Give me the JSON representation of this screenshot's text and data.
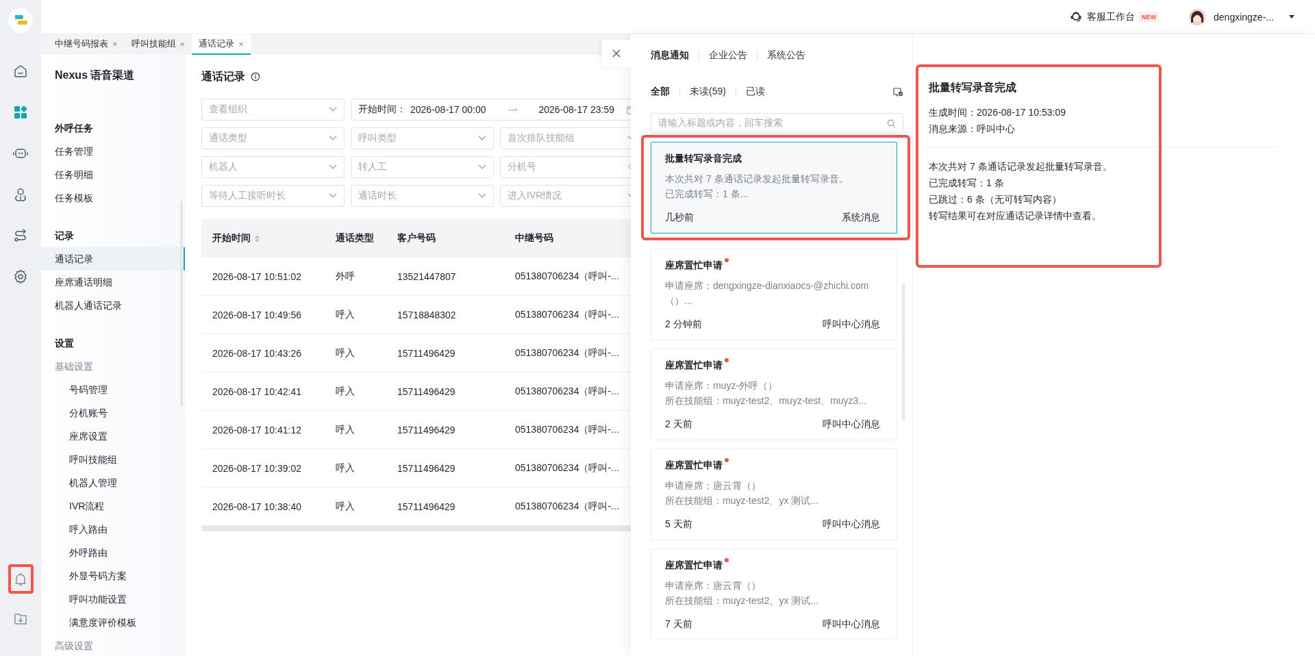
{
  "rail": {
    "items": [
      {
        "selected": false
      },
      {
        "selected": true
      },
      {
        "selected": false
      },
      {
        "selected": false
      },
      {
        "selected": false
      },
      {
        "selected": false
      }
    ],
    "bottom": [
      {
        "highlighted": true
      },
      {
        "highlighted": false
      }
    ]
  },
  "top_bar": {
    "workbench": "客服工作台",
    "badge": "NEW",
    "user": "dengxingze-..."
  },
  "tabs": [
    {
      "label": "中继号码报表",
      "close": "×",
      "selected": false
    },
    {
      "label": "呼叫技能组",
      "close": "×",
      "selected": false
    },
    {
      "label": "通话记录",
      "close": "×",
      "selected": true
    }
  ],
  "nav": {
    "title": "Nexus 语音渠道",
    "groups": [
      {
        "heading": "外呼任务",
        "items": [
          {
            "kind": "link",
            "label": "任务管理",
            "selected": false
          },
          {
            "kind": "link",
            "label": "任务明细",
            "selected": false
          },
          {
            "kind": "link",
            "label": "任务模板",
            "selected": false
          }
        ]
      },
      {
        "heading": "记录",
        "items": [
          {
            "kind": "link",
            "label": "通话记录",
            "selected": true
          },
          {
            "kind": "link",
            "label": "座席通话明细",
            "selected": false
          },
          {
            "kind": "link",
            "label": "机器人通话记录",
            "selected": false
          }
        ]
      },
      {
        "heading": "设置",
        "items": [
          {
            "kind": "section",
            "label": "基础设置",
            "children": [
              {
                "label": "号码管理",
                "selected": false
              },
              {
                "label": "分机账号",
                "selected": false
              },
              {
                "label": "座席设置",
                "selected": false
              },
              {
                "label": "呼叫技能组",
                "selected": false
              },
              {
                "label": "机器人管理",
                "selected": false
              },
              {
                "label": "IVR流程",
                "selected": false
              },
              {
                "label": "呼入路由",
                "selected": false
              },
              {
                "label": "外呼路由",
                "selected": false
              },
              {
                "label": "外显号码方案",
                "selected": false
              },
              {
                "label": "呼叫功能设置",
                "selected": false
              },
              {
                "label": "满意度评价模板",
                "selected": false
              }
            ]
          },
          {
            "kind": "section",
            "label": "高级设置"
          }
        ]
      }
    ]
  },
  "page": {
    "title": "通话记录",
    "filters": [
      {
        "kind": "select",
        "placeholder": "查看组织"
      },
      {
        "kind": "range",
        "label": "开始时间：",
        "start": "2026-08-17 00:00",
        "end": "2026-08-17 23:59"
      },
      {
        "kind": "select",
        "placeholder": "通话类型"
      },
      {
        "kind": "select",
        "placeholder": "呼叫类型"
      },
      {
        "kind": "select",
        "placeholder": "首次排队技能组"
      },
      {
        "kind": "select",
        "placeholder": "机器人"
      },
      {
        "kind": "select",
        "placeholder": "转人工"
      },
      {
        "kind": "search",
        "placeholder": "分机号"
      },
      {
        "kind": "select",
        "placeholder": "等待人工接听时长"
      },
      {
        "kind": "select",
        "placeholder": "通话时长"
      },
      {
        "kind": "select",
        "placeholder": "进入IVR情况"
      }
    ],
    "table": {
      "columns": [
        {
          "label": "开始时间",
          "sortable": true
        },
        {
          "label": "通话类型",
          "sortable": false
        },
        {
          "label": "客户号码",
          "sortable": false
        },
        {
          "label": "中继号码",
          "sortable": false
        }
      ],
      "rows": [
        [
          "2026-08-17 10:51:02",
          "外呼",
          "13521447807",
          "051380706234（呼叫-..."
        ],
        [
          "2026-08-17 10:49:56",
          "呼入",
          "15718848302",
          "051380706234（呼叫-..."
        ],
        [
          "2026-08-17 10:43:26",
          "呼入",
          "15711496429",
          "051380706234（呼叫-..."
        ],
        [
          "2026-08-17 10:42:41",
          "呼入",
          "15711496429",
          "051380706234（呼叫-..."
        ],
        [
          "2026-08-17 10:41:12",
          "呼入",
          "15711496429",
          "051380706234（呼叫-..."
        ],
        [
          "2026-08-17 10:39:02",
          "呼入",
          "15711496429",
          "051380706234（呼叫-..."
        ],
        [
          "2026-08-17 10:38:40",
          "呼入",
          "15711496429",
          "051380706234（呼叫-..."
        ]
      ]
    }
  },
  "drawer": {
    "tabs": [
      {
        "label": "消息通知",
        "selected": true
      },
      {
        "label": "企业公告",
        "selected": false
      },
      {
        "label": "系统公告",
        "selected": false
      }
    ],
    "filters": [
      {
        "label": "全部",
        "selected": true
      },
      {
        "label": "未读(59)",
        "selected": false
      },
      {
        "label": "已读",
        "selected": false
      }
    ],
    "search": {
      "placeholder": "请输入标题或内容，回车搜索"
    },
    "cards": [
      {
        "title": "批量转写录音完成",
        "unread": false,
        "selected": true,
        "highlighted": true,
        "lines": [
          "本次共对 7 条通话记录发起批量转写录音。",
          "已完成转写：1 条..."
        ],
        "time": "几秒前",
        "source": "系统消息"
      },
      {
        "title": "座席置忙申请",
        "unread": true,
        "selected": false,
        "highlighted": false,
        "lines": [
          "申请座席：dengxingze-dianxiaocs-@zhichi.com",
          "（）..."
        ],
        "time": "2 分钟前",
        "source": "呼叫中心消息"
      },
      {
        "title": "座席置忙申请",
        "unread": true,
        "selected": false,
        "highlighted": false,
        "lines": [
          "申请座席：muyz-外呼（）",
          "所在技能组：muyz-test2、muyz-test、muyz3..."
        ],
        "time": "2 天前",
        "source": "呼叫中心消息"
      },
      {
        "title": "座席置忙申请",
        "unread": true,
        "selected": false,
        "highlighted": false,
        "lines": [
          "申请座席：唐云霄（）",
          "所在技能组：muyz-test2、yx 测试..."
        ],
        "time": "5 天前",
        "source": "呼叫中心消息"
      },
      {
        "title": "座席置忙申请",
        "unread": true,
        "selected": false,
        "highlighted": false,
        "lines": [
          "申请座席：唐云霄（）",
          "所在技能组：muyz-test2、yx 测试..."
        ],
        "time": "7 天前",
        "source": "呼叫中心消息"
      }
    ],
    "detail": {
      "title": "批量转写录音完成",
      "highlighted": true,
      "meta": [
        "生成时间：2026-08-17 10:53:09",
        "消息来源：呼叫中心"
      ],
      "body": [
        "本次共对 7 条通话记录发起批量转写录音。",
        "已完成转写：1 条",
        "已跳过：6 条（无可转写内容）",
        "转写结果可在对应通话记录详情中查看。"
      ]
    }
  }
}
